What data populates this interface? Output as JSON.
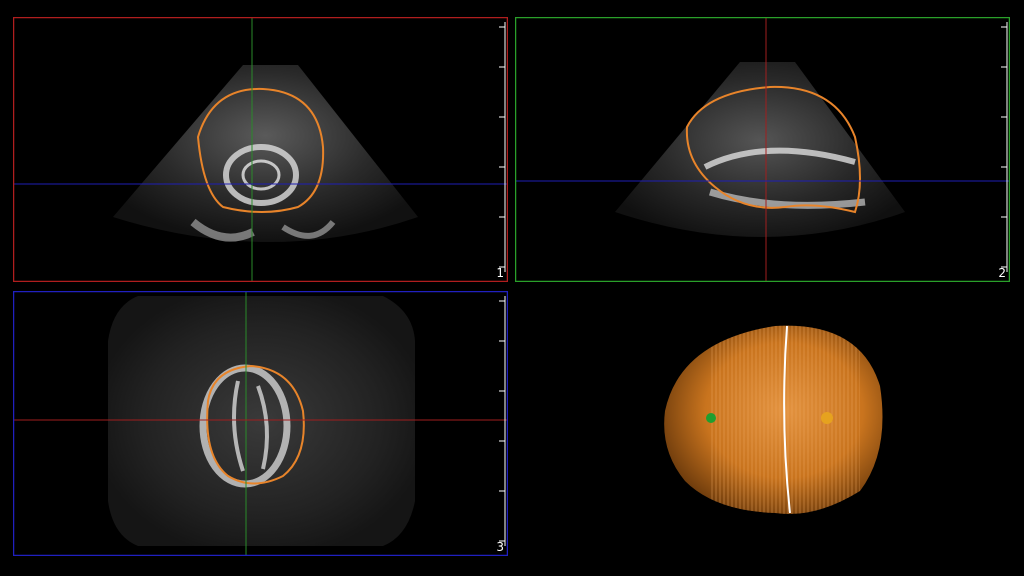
{
  "views": [
    {
      "id": "view-1",
      "number": "1",
      "border_color": "#b01e1e",
      "vline_color": "#2a8a2a",
      "hline_color": "#1e1eb4"
    },
    {
      "id": "view-2",
      "number": "2",
      "border_color": "#2aa02a",
      "vline_color": "#a01e1e",
      "hline_color": "#1e1eb4"
    },
    {
      "id": "view-3",
      "number": "3",
      "border_color": "#2020c0",
      "vline_color": "#2a8a2a",
      "hline_color": "#a01e1e"
    }
  ],
  "contour_color": "#e8842a",
  "volume": {
    "fill_color": "#c9741e",
    "marker_left_color": "#1f9e2f",
    "marker_right_color": "#e6a21f"
  }
}
